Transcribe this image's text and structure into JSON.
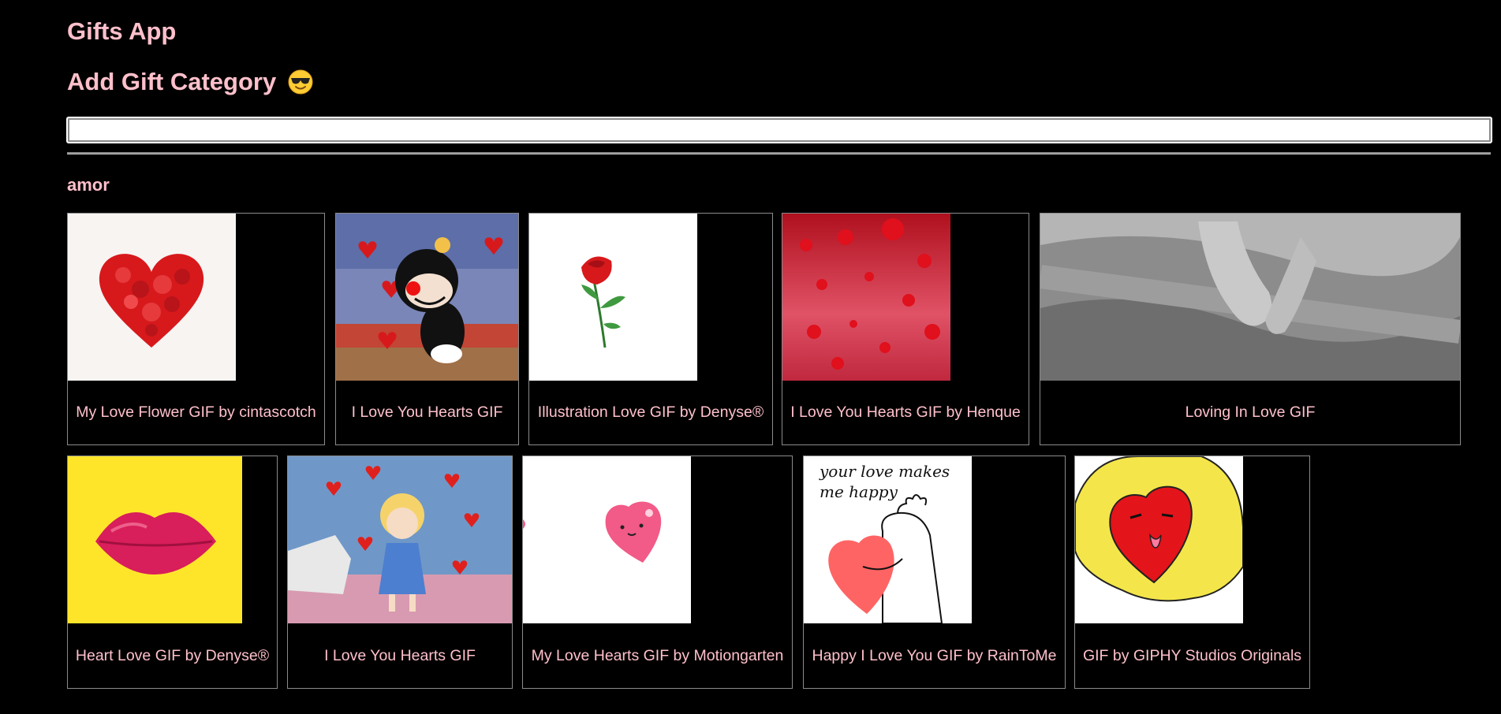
{
  "header": {
    "app_title": "Gifts App",
    "add_category_title": "Add Gift Category",
    "add_category_emoji": "smiling-face-with-sunglasses-icon"
  },
  "search": {
    "value": "",
    "placeholder": ""
  },
  "category": {
    "name": "amor",
    "gifs": [
      {
        "title": "My Love Flower GIF by cintascotch",
        "icon": "rose-petal-heart-icon"
      },
      {
        "title": "I Love You Hearts GIF",
        "icon": "cartoon-character-hearts-icon"
      },
      {
        "title": "Illustration Love GIF by Denyse®",
        "icon": "red-rose-icon"
      },
      {
        "title": "I Love You Hearts GIF by Henque",
        "icon": "falling-red-hearts-icon"
      },
      {
        "title": "Loving In Love GIF",
        "icon": "holding-hands-photo-icon"
      },
      {
        "title": "Heart Love GIF by Denyse®",
        "icon": "red-lips-icon"
      },
      {
        "title": "I Love You Hearts GIF",
        "icon": "cartoon-girl-hearts-icon"
      },
      {
        "title": "My Love Hearts GIF by Motiongarten",
        "icon": "pink-smiling-heart-icon"
      },
      {
        "title": "Happy I Love You GIF by RainToMe",
        "icon": "hug-heart-sketch-icon"
      },
      {
        "title": "GIF by GIPHY Studios Originals",
        "icon": "hands-holding-heart-icon"
      }
    ],
    "sketch_text_line1": "your love makes",
    "sketch_text_line2": "me happy"
  },
  "colors": {
    "background": "#000000",
    "accent": "#ffc0cb",
    "card_border": "#8b8b8b"
  }
}
